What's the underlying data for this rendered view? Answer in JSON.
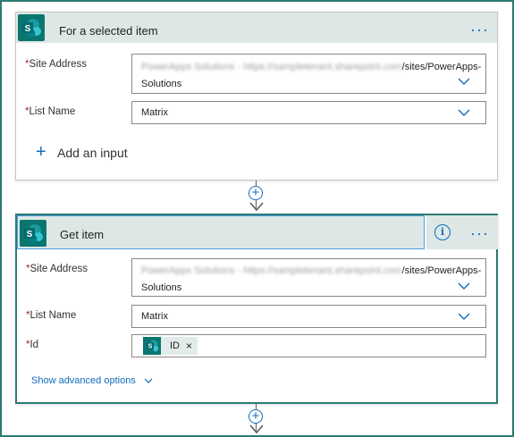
{
  "trigger": {
    "title": "For a selected item",
    "more_label": "···",
    "site_address": {
      "label": "Site Address",
      "blurred_prefix": "PowerApps Solutions - https://sampletenant.sharepoint.com",
      "line1_suffix": "/sites/PowerApps-",
      "line2": "Solutions"
    },
    "list_name": {
      "label": "List Name",
      "value": "Matrix"
    },
    "add_input_label": "Add an input"
  },
  "action": {
    "title": "Get item",
    "more_label": "···",
    "info_label": "i",
    "site_address": {
      "label": "Site Address",
      "blurred_prefix": "PowerApps Solutions - https://sampletenant.sharepoint.com",
      "line1_suffix": "/sites/PowerApps-",
      "line2": "Solutions"
    },
    "list_name": {
      "label": "List Name",
      "value": "Matrix"
    },
    "id": {
      "label": "Id",
      "token_label": "ID",
      "token_remove": "×"
    },
    "show_advanced_label": "Show advanced options"
  },
  "colors": {
    "accent": "#0f6cbd",
    "header_bg": "#dde8e6",
    "sharepoint": "#0b7570",
    "required": "#a4262c",
    "frame": "#2d7a73"
  },
  "icons": {
    "connector": "sharepoint-icon",
    "dropdown": "chevron-down-icon",
    "add": "plus-icon",
    "insert_step": "plus-circle-icon",
    "info": "info-icon"
  }
}
